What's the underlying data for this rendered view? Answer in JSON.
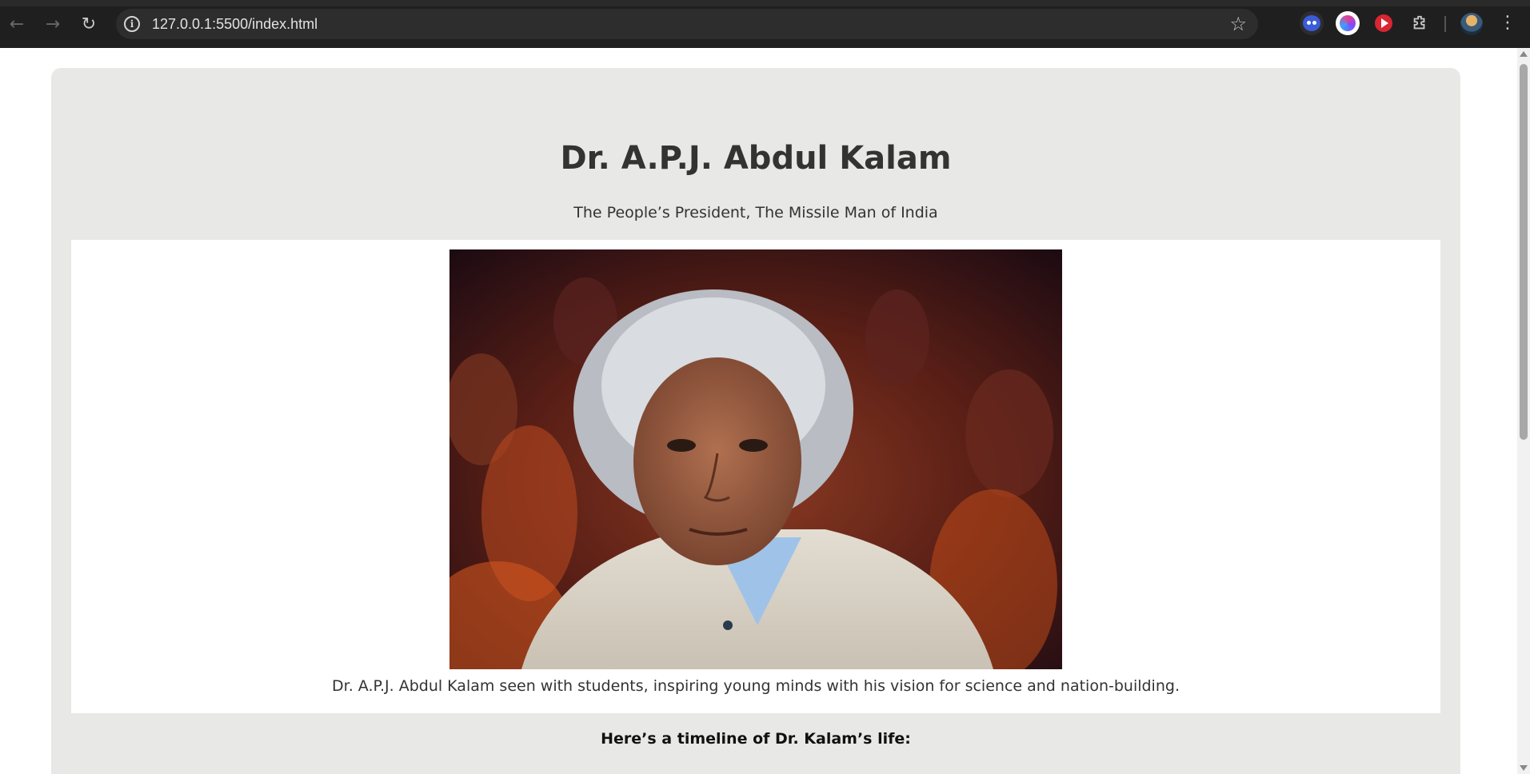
{
  "browser": {
    "url": "127.0.0.1:5500/index.html",
    "back_icon": "arrow-left-icon",
    "forward_icon": "arrow-right-icon",
    "reload_icon": "reload-icon",
    "site_info_icon": "info-icon",
    "bookmark_icon": "star-icon",
    "extensions": [
      "bot-extension-icon",
      "brain-extension-icon",
      "play-extension-icon",
      "puzzle-extensions-icon"
    ],
    "profile_icon": "avatar",
    "menu_icon": "kebab-menu-icon"
  },
  "page": {
    "title": "Dr. A.P.J. Abdul Kalam",
    "subtitle": "The People’s President, The Missile Man of India",
    "image_caption": "Dr. A.P.J. Abdul Kalam seen with students, inspiring young minds with his vision for science and nation-building.",
    "timeline_intro": "Here’s a timeline of Dr. Kalam’s life:"
  },
  "colors": {
    "chrome_bg": "#1f1f1f",
    "omnibox_bg": "#2d2d2d",
    "container_bg": "#e8e8e6",
    "figure_bg": "#ffffff",
    "text": "#333333"
  }
}
